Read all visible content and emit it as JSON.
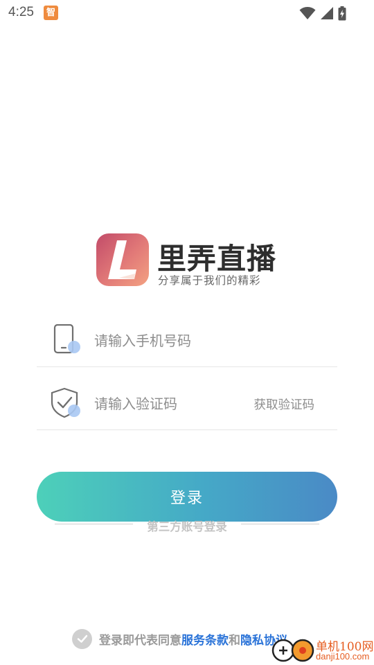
{
  "status_bar": {
    "time": "4:25",
    "notification_badge": "智",
    "icons": [
      "wifi-icon",
      "signal-icon",
      "battery-charging-icon"
    ]
  },
  "logo": {
    "letter": "L",
    "app_name": "里弄直播",
    "slogan": "分享属于我们的精彩"
  },
  "form": {
    "phone_placeholder": "请输入手机号码",
    "code_placeholder": "请输入验证码",
    "get_code_label": "获取验证码",
    "login_label": "登录"
  },
  "third_party": {
    "label": "第三方账号登录"
  },
  "agreement": {
    "prefix": "登录即代表同意",
    "terms_link": "服务条款",
    "and": "和",
    "privacy_link": "隐私协议"
  },
  "watermark": {
    "title": "单机100网",
    "url": "danji100.com"
  },
  "colors": {
    "login_gradient_start": "#4dd0b9",
    "login_gradient_end": "#4a8ac6",
    "logo_gradient_start": "#c24b69",
    "logo_gradient_end": "#f3a282",
    "link": "#2a73d8",
    "notification": "#ef8b3e",
    "watermark": "#e65d21"
  }
}
